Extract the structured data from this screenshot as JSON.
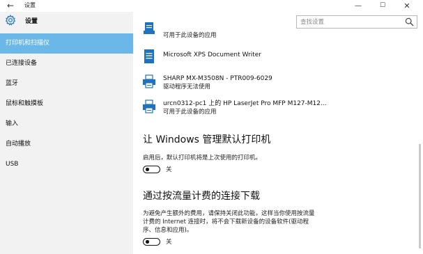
{
  "window": {
    "title": "设置",
    "back_icon": "back-arrow-icon",
    "minimize_glyph": "—",
    "maximize_glyph": "☐",
    "close_glyph": "✕"
  },
  "sidebar": {
    "app_name": "设置",
    "app_icon": "gear-icon",
    "items": [
      {
        "label": "打印机和扫描仪",
        "active": true
      },
      {
        "label": "已连接设备",
        "active": false
      },
      {
        "label": "蓝牙",
        "active": false
      },
      {
        "label": "鼠标和触摸板",
        "active": false
      },
      {
        "label": "输入",
        "active": false
      },
      {
        "label": "自动播放",
        "active": false
      },
      {
        "label": "USB",
        "active": false
      }
    ],
    "accent_color": "#6bb8e8"
  },
  "search": {
    "placeholder": "查找设置",
    "icon": "search-icon"
  },
  "printers": [
    {
      "name": "",
      "status": "可用于此设备的应用",
      "icon": "document-printer-icon"
    },
    {
      "name": "Microsoft XPS Document Writer",
      "status": "",
      "icon": "document-printer-icon"
    },
    {
      "name": "SHARP MX-M3508N - PTR009-6029",
      "status": "驱动程序无法使用",
      "icon": "printer-icon"
    },
    {
      "name": "urcn0312-pc1 上的 HP LaserJet Pro MFP M127-M12...",
      "status": "可用于此设备的应用",
      "icon": "printer-icon"
    }
  ],
  "settings": {
    "default_printer": {
      "title": "让 Windows 管理默认打印机",
      "description": "启用后，默认打印机将是上次使用的打印机。",
      "toggle_label": "关",
      "state": "off"
    },
    "metered_download": {
      "title": "通过按流量计费的连接下载",
      "description_lines": [
        "为避免产生额外的费用，请保持关闭此功能，这样当你使用按流量",
        "计费的 Internet 连接时，将不会下载新设备的设备软件(驱动程",
        "序、信息和应用)。"
      ],
      "toggle_label": "关",
      "state": "off"
    }
  }
}
